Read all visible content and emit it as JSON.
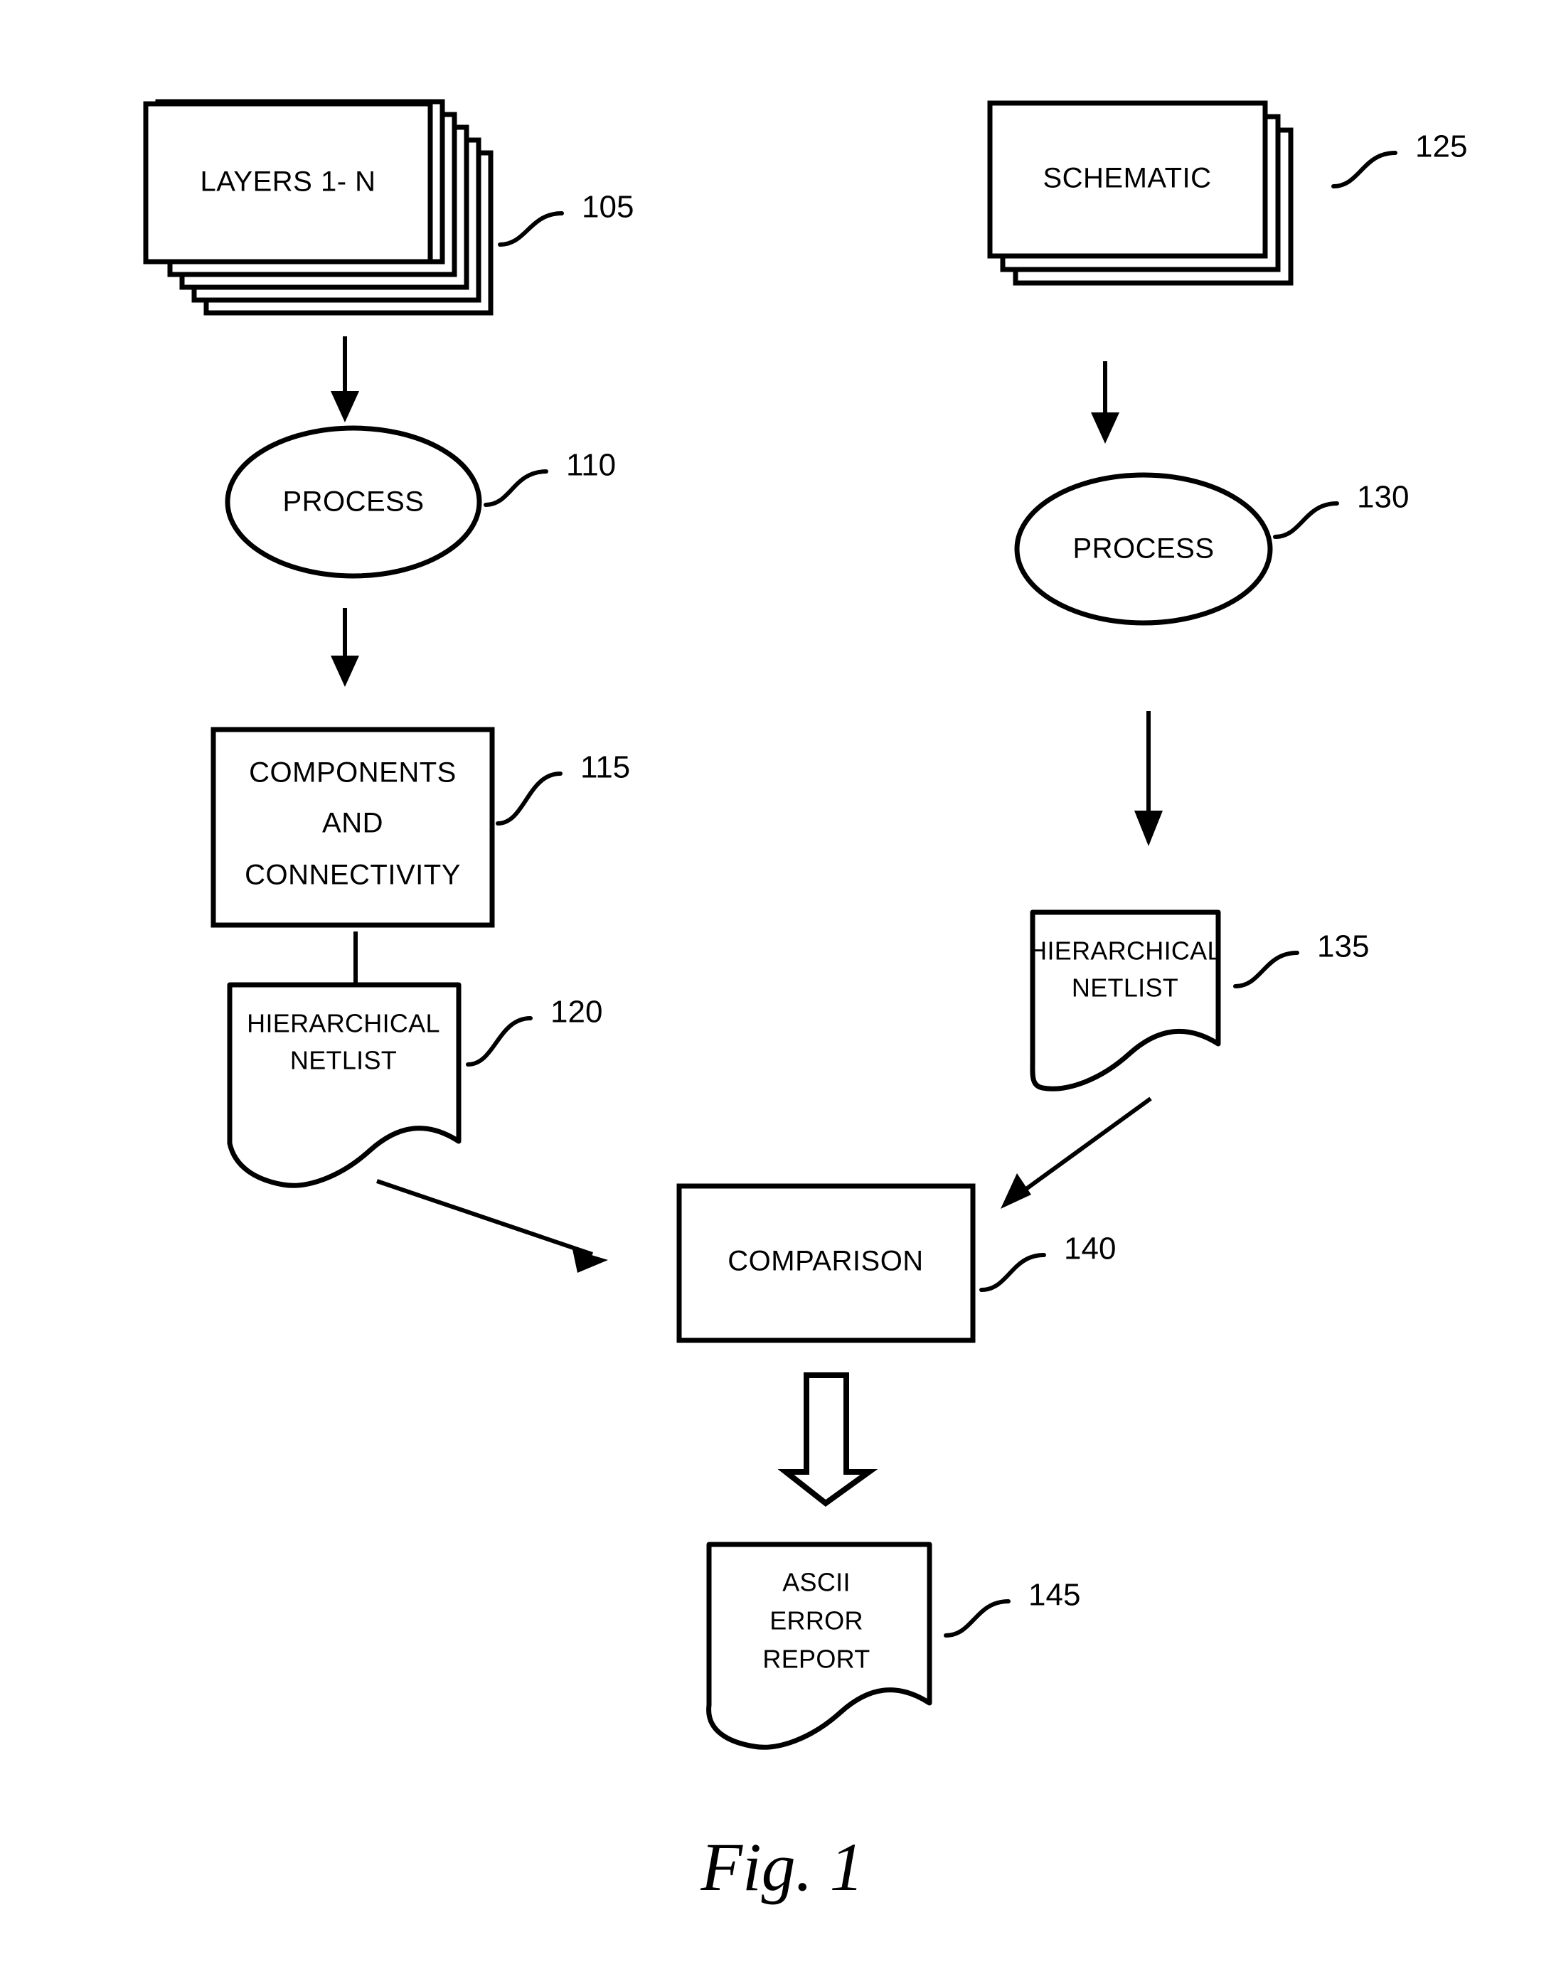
{
  "figure": {
    "caption": "Fig. 1",
    "domain_note": "patent flow diagram"
  },
  "nodes": {
    "layers": {
      "label": "LAYERS 1- N",
      "ref": "105",
      "shape": "document-stack",
      "stack_count": 6
    },
    "process_layout": {
      "label": "PROCESS",
      "ref": "110",
      "shape": "ellipse"
    },
    "components": {
      "label_line1": "COMPONENTS",
      "label_line2": "AND",
      "label_line3": "CONNECTIVITY",
      "ref": "115",
      "shape": "rectangle"
    },
    "netlist_layout": {
      "label_line1": "HIERARCHICAL",
      "label_line2": "NETLIST",
      "ref": "120",
      "shape": "document"
    },
    "schematic": {
      "label": "SCHEMATIC",
      "ref": "125",
      "shape": "document-stack",
      "stack_count": 3
    },
    "process_schematic": {
      "label": "PROCESS",
      "ref": "130",
      "shape": "ellipse"
    },
    "netlist_schematic": {
      "label_line1": "HIERARCHICAL",
      "label_line2": "NETLIST",
      "ref": "135",
      "shape": "document"
    },
    "comparison": {
      "label": "COMPARISON",
      "ref": "140",
      "shape": "rectangle"
    },
    "error_report": {
      "label_line1": "ASCII",
      "label_line2": "ERROR",
      "label_line3": "REPORT",
      "ref": "145",
      "shape": "document"
    }
  },
  "colors": {
    "ink": "#000000",
    "paper": "#ffffff"
  }
}
